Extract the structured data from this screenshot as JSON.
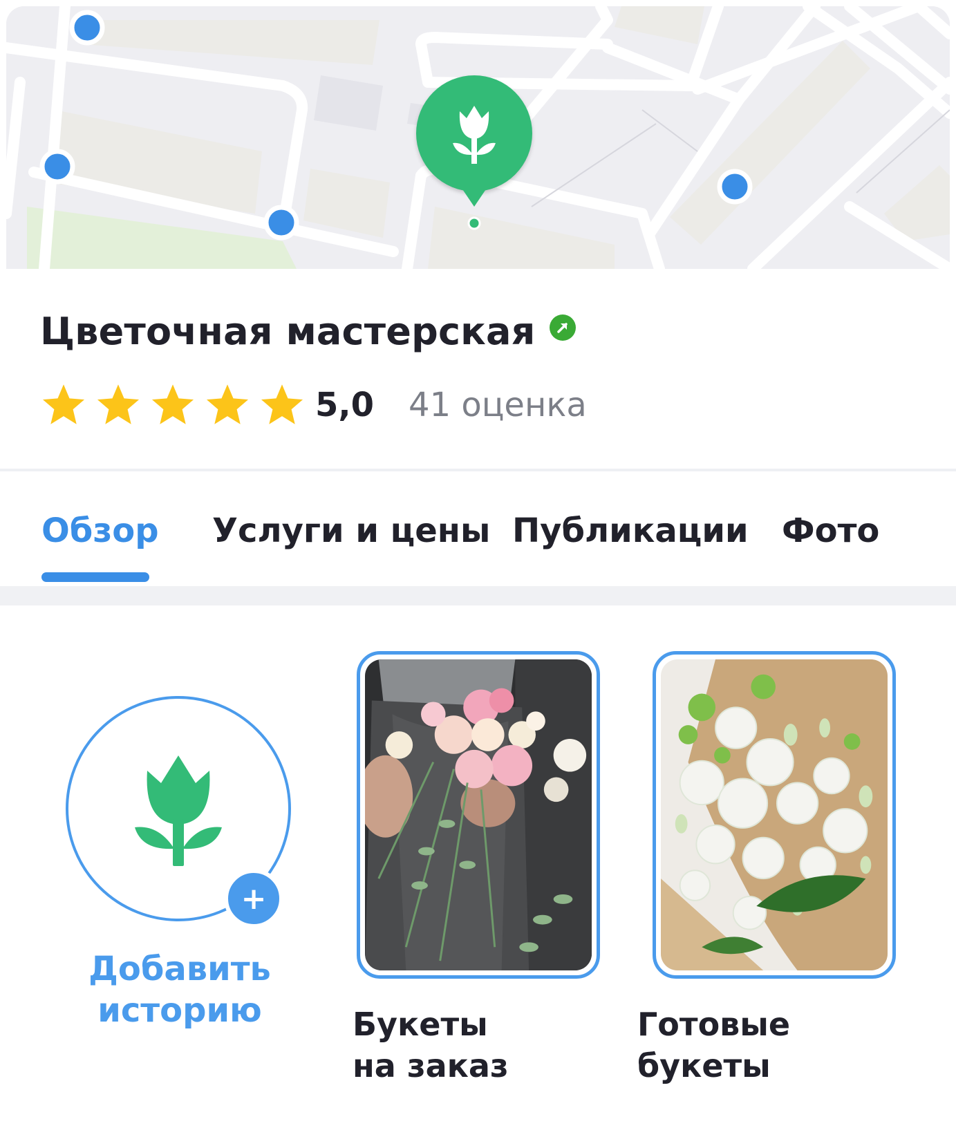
{
  "map": {
    "pin_icon": "tulip-icon",
    "colors": {
      "pin": "#33bb77",
      "poi": "#3a8ee6",
      "background": "#eeeef2",
      "roads": "#ffffff",
      "buildings": "#ecebe7",
      "park": "#e3f0d9"
    }
  },
  "org": {
    "name": "Цветочная мастерская",
    "verified_icon": "verified-arrow-icon",
    "rating": "5,0",
    "stars": 5,
    "rating_count": "41 оценка"
  },
  "tabs": [
    {
      "label": "Обзор",
      "active": true
    },
    {
      "label": "Услуги и цены",
      "active": false
    },
    {
      "label": "Публикации",
      "active": false
    },
    {
      "label": "Фото",
      "active": false
    }
  ],
  "stories": {
    "add_label_line1": "Добавить",
    "add_label_line2": "историю",
    "items": [
      {
        "line1": "Букеты",
        "line2": "на заказ"
      },
      {
        "line1": "Готовые",
        "line2": "букеты"
      }
    ]
  },
  "colors": {
    "accent": "#3a8ee6",
    "verified": "#3aaa35",
    "star": "#fcc419",
    "text": "#21212b",
    "muted": "#7c7f88"
  }
}
